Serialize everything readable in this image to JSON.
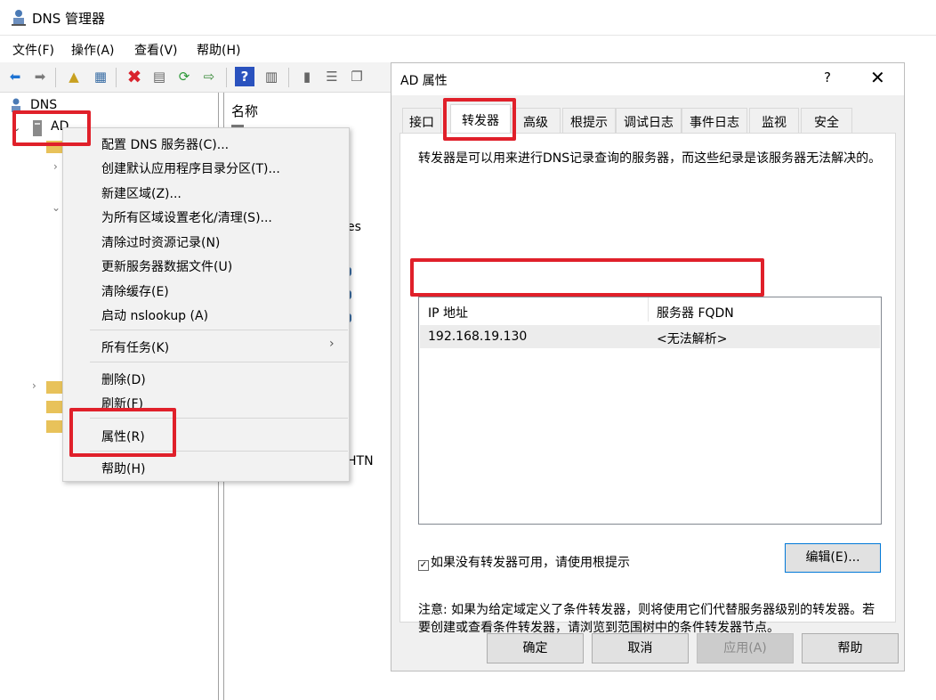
{
  "window": {
    "title": "DNS 管理器"
  },
  "menubar": [
    "文件(F)",
    "操作(A)",
    "查看(V)",
    "帮助(H)"
  ],
  "tree": {
    "root": "DNS",
    "server": "AD"
  },
  "list_pane": {
    "column_name": "名称",
    "fragment_es": "es",
    "fragment_htn": "HTN"
  },
  "context_menu": {
    "items": [
      "配置 DNS 服务器(C)...",
      "创建默认应用程序目录分区(T)...",
      "新建区域(Z)...",
      "为所有区域设置老化/清理(S)...",
      "清除过时资源记录(N)",
      "更新服务器数据文件(U)",
      "清除缓存(E)",
      "启动 nslookup (A)",
      "所有任务(K)",
      "删除(D)",
      "刷新(F)",
      "属性(R)",
      "帮助(H)"
    ],
    "submenu_arrow": "›"
  },
  "dialog": {
    "title": "AD 属性",
    "help_glyph": "?",
    "close_glyph": "✕",
    "tabs": [
      "接口",
      "转发器",
      "高级",
      "根提示",
      "调试日志",
      "事件日志",
      "监视",
      "安全"
    ],
    "active_tab": "转发器",
    "description": "转发器是可以用来进行DNS记录查询的服务器，而这些纪录是该服务器无法解决的。",
    "columns": {
      "ip": "IP 地址",
      "fqdn": "服务器 FQDN"
    },
    "rows": [
      {
        "ip": "192.168.19.130",
        "fqdn": "<无法解析>"
      }
    ],
    "use_root_hints": {
      "checked": true,
      "label": "如果没有转发器可用，请使用根提示"
    },
    "edit_button": "编辑(E)...",
    "note": "注意: 如果为给定域定义了条件转发器，则将使用它们代替服务器级别的转发器。若要创建或查看条件转发器，请浏览到范围树中的条件转发器节点。",
    "buttons": {
      "ok": "确定",
      "cancel": "取消",
      "apply": "应用(A)",
      "help": "帮助"
    }
  },
  "colors": {
    "annotation": "#e0202a",
    "focus_border": "#0078d7"
  }
}
